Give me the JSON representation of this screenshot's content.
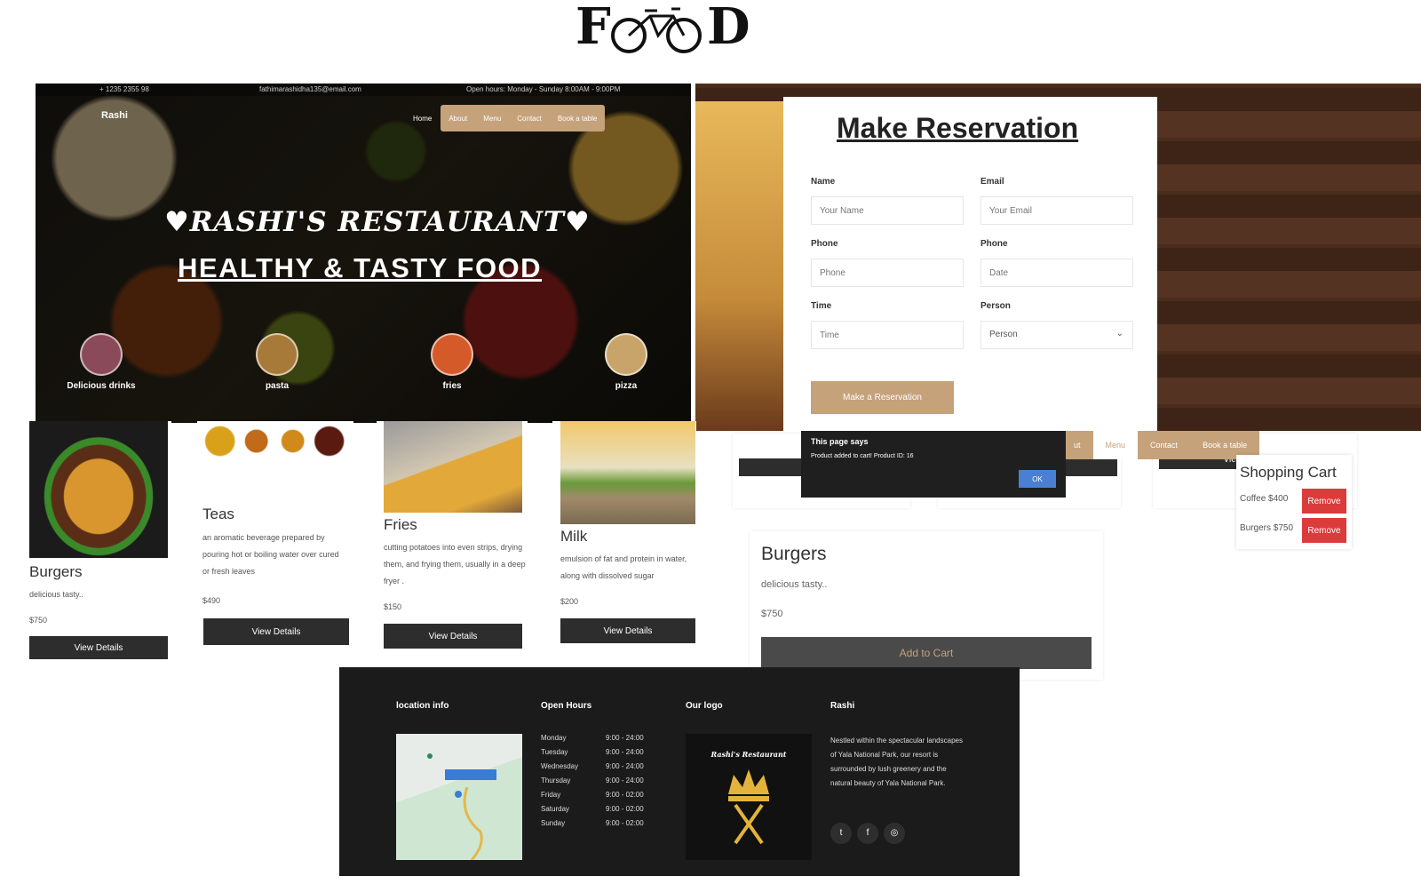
{
  "logo": {
    "left": "F",
    "right": "D"
  },
  "hero": {
    "phone": "+ 1235 2355 98",
    "email": "fathimarashidha135@email.com",
    "hours": "Open hours: Monday - Sunday 8:00AM - 9:00PM",
    "brand": "Rashi",
    "nav": {
      "home": "Home",
      "about": "About",
      "menu": "Menu",
      "contact": "Contact",
      "book": "Book a table"
    },
    "title": "RASHI'S RESTAURANT",
    "subtitle": "HEALTHY & TASTY FOOD",
    "categories": [
      {
        "label": "Delicious drinks",
        "color": "#8a4a5a"
      },
      {
        "label": "pasta",
        "color": "#a87a3a"
      },
      {
        "label": "fries",
        "color": "#d45a2a"
      },
      {
        "label": "pizza",
        "color": "#c8a46a"
      }
    ]
  },
  "reservation": {
    "title": "Make Reservation",
    "name_label": "Name",
    "name_ph": "Your Name",
    "email_label": "Email",
    "email_ph": "Your Email",
    "phone_label": "Phone",
    "phone_ph": "Phone",
    "date_label": "Phone",
    "date_ph": "Date",
    "time_label": "Time",
    "time_ph": "Time",
    "person_label": "Person",
    "person_value": "Person",
    "button": "Make a Reservation"
  },
  "products": [
    {
      "title": "Burgers",
      "desc": "delicious tasty..",
      "price": "$750",
      "button": "View Details"
    },
    {
      "title": "Teas",
      "desc": "an aromatic beverage prepared by pouring hot or boiling water over cured or fresh leaves",
      "price": "$490",
      "button": "View Details"
    },
    {
      "title": "Fries",
      "desc": "cutting potatoes into even strips, drying them, and frying them, usually in a deep fryer .",
      "price": "$150",
      "button": "View Details"
    },
    {
      "title": "Milk",
      "desc": "emulsion of fat and protein in water, along with dissolved sugar",
      "price": "$200",
      "button": "View Details"
    }
  ],
  "dialog": {
    "title": "This page says",
    "message": "Product added to cart! Product ID: 16",
    "ok": "OK"
  },
  "cartnav": {
    "about": "ut",
    "menu": "Menu",
    "contact": "Contact",
    "book": "Book a table"
  },
  "cart": {
    "title": "Shopping Cart",
    "items": [
      {
        "label": "Coffee  $400",
        "remove": "Remove"
      },
      {
        "label": "Burgers $750",
        "remove": "Remove"
      }
    ]
  },
  "detail": {
    "title": "Burgers",
    "desc": "delicious tasty..",
    "price": "$750",
    "button": "Add to Cart",
    "view_partial": "View"
  },
  "footer": {
    "location": "location info",
    "hours_title": "Open Hours",
    "logo_title": "Our logo",
    "about_title": "Rashi",
    "hours": [
      {
        "day": "Monday",
        "time": "9:00 - 24:00"
      },
      {
        "day": "Tuesday",
        "time": "9:00 - 24:00"
      },
      {
        "day": "Wednesday",
        "time": "9:00 - 24:00"
      },
      {
        "day": "Thursday",
        "time": "9:00 - 24:00"
      },
      {
        "day": "Friday",
        "time": "9:00 - 02:00"
      },
      {
        "day": "Saturday",
        "time": "9:00 - 02:00"
      },
      {
        "day": "Sunday",
        "time": "9:00 - 02:00"
      }
    ],
    "logo_text": "Rashi's Restaurant",
    "about": "Nestled within the spectacular landscapes of Yala National Park, our resort is surrounded by lush greenery and the natural beauty of Yala National Park.",
    "icons": [
      "twitter-icon",
      "facebook-icon",
      "instagram-icon"
    ]
  },
  "colors": {
    "accent": "#c5a27a",
    "dark": "#2d2d2d",
    "danger": "#dc3b3b",
    "footer": "#1b1b1b"
  }
}
